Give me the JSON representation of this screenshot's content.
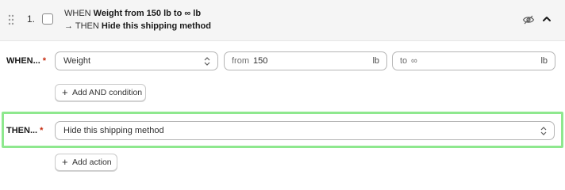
{
  "rule": {
    "index": "1.",
    "summary": {
      "when_prefix": "WHEN",
      "when_condition": "Weight from 150 lb to ∞ lb",
      "then_prefix": "→ THEN",
      "then_action": "Hide this shipping method"
    }
  },
  "when_row": {
    "label": "WHEN...",
    "required_mark": "*",
    "field_select": "Weight",
    "from_prefix": "from",
    "from_value": "150",
    "from_unit": "lb",
    "to_prefix": "to",
    "to_value": "∞",
    "to_unit": "lb",
    "add_condition_label": "Add AND condition"
  },
  "then_row": {
    "label": "THEN...",
    "required_mark": "*",
    "action_select": "Hide this shipping method",
    "add_action_label": "Add action"
  },
  "icons": {
    "drag": "drag-handle-icon",
    "hidden": "eye-off-icon",
    "collapse": "chevron-up-icon",
    "select": "select-chevrons-icon",
    "plus": "plus-icon"
  },
  "colors": {
    "highlight": "#8ee88e",
    "required": "#c5280c",
    "header_bg": "#f5f5f5"
  }
}
